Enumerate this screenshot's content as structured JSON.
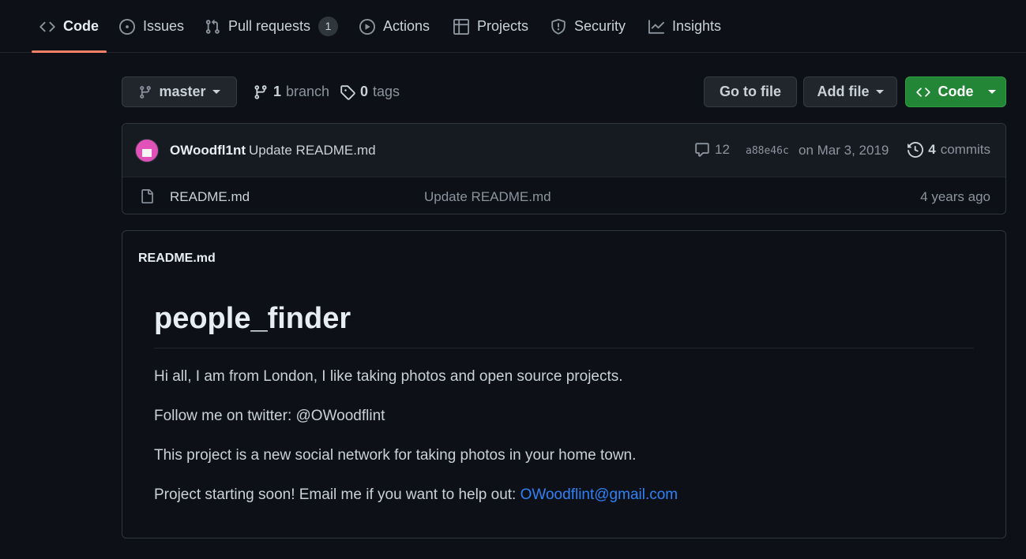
{
  "nav": {
    "tabs": [
      {
        "label": "Code",
        "icon": "code-icon",
        "active": true
      },
      {
        "label": "Issues",
        "icon": "issue-opened-icon"
      },
      {
        "label": "Pull requests",
        "icon": "pull-request-icon",
        "count": "1"
      },
      {
        "label": "Actions",
        "icon": "play-icon"
      },
      {
        "label": "Projects",
        "icon": "table-icon"
      },
      {
        "label": "Security",
        "icon": "shield-icon"
      },
      {
        "label": "Insights",
        "icon": "graph-icon"
      }
    ],
    "accent": "#f78166"
  },
  "toolbar": {
    "branch": "master",
    "branch_count": "1",
    "branch_label": "branch",
    "tag_count": "0",
    "tag_label": "tags",
    "go_to_file": "Go to file",
    "add_file": "Add file",
    "code": "Code",
    "code_button_color": "#238636"
  },
  "latest_commit": {
    "author": "OWoodfl1nt",
    "message": "Update README.md",
    "comment_count": "12",
    "sha": "a88e46c",
    "date": "on Mar 3, 2019",
    "commit_count": "4",
    "commit_label": "commits"
  },
  "files": [
    {
      "name": "README.md",
      "icon": "file-icon",
      "commit_message": "Update README.md",
      "age": "4 years ago"
    }
  ],
  "readme": {
    "filename": "README.md",
    "heading": "people_finder",
    "paragraphs": [
      "Hi all, I am from London, I like taking photos and open source projects.",
      "Follow me on twitter: @OWoodflint",
      "This project is a new social network for taking photos in your home town."
    ],
    "email_prefix": "Project starting soon! Email me if you want to help out: ",
    "email": "OWoodflint@gmail.com",
    "link_color": "#2f81f7"
  }
}
